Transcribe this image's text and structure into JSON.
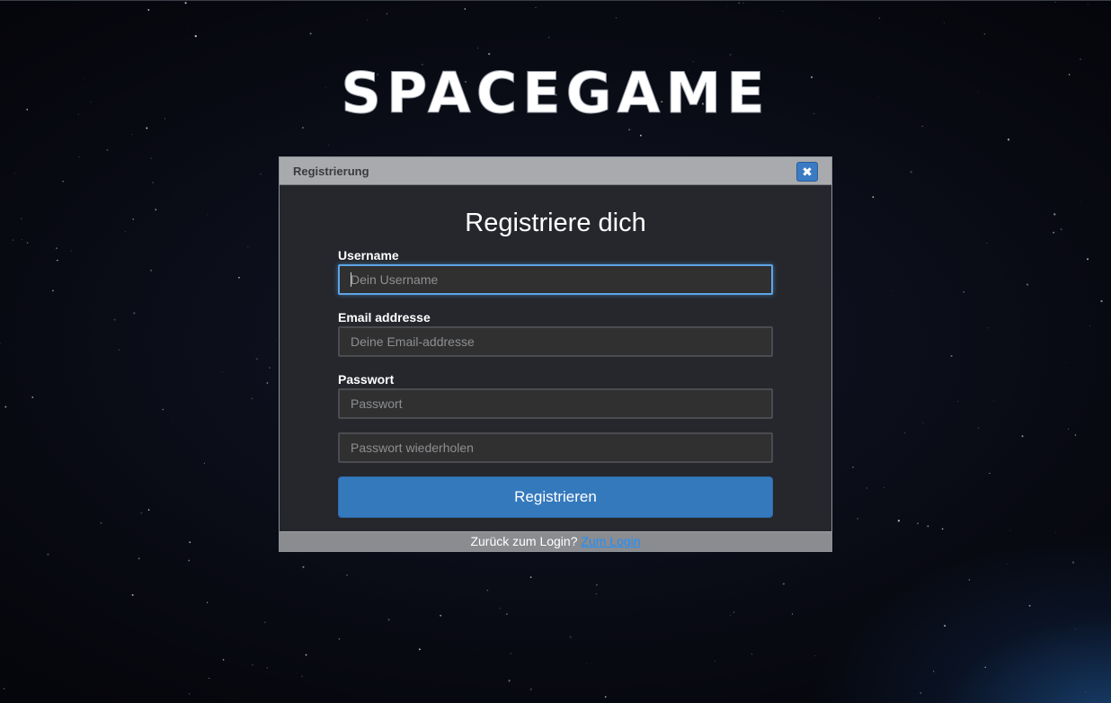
{
  "logo": {
    "text": "SPACEGAME"
  },
  "dialog": {
    "title": "Registrierung",
    "close_icon": "close-icon",
    "heading": "Registriere dich",
    "fields": {
      "username": {
        "label": "Username",
        "placeholder": "Dein Username",
        "value": ""
      },
      "email": {
        "label": "Email addresse",
        "placeholder": "Deine Email-addresse",
        "value": ""
      },
      "password": {
        "label": "Passwort",
        "placeholder": "Passwort",
        "value": ""
      },
      "password_repeat": {
        "placeholder": "Passwort wiederholen",
        "value": ""
      }
    },
    "submit_label": "Registrieren",
    "footer": {
      "text": "Zurück zum Login?",
      "link": "Zum Login"
    }
  },
  "colors": {
    "accent": "#3579bd",
    "focus": "#5ea5e8",
    "link": "#1e8fff",
    "header": "#a9aaad"
  }
}
